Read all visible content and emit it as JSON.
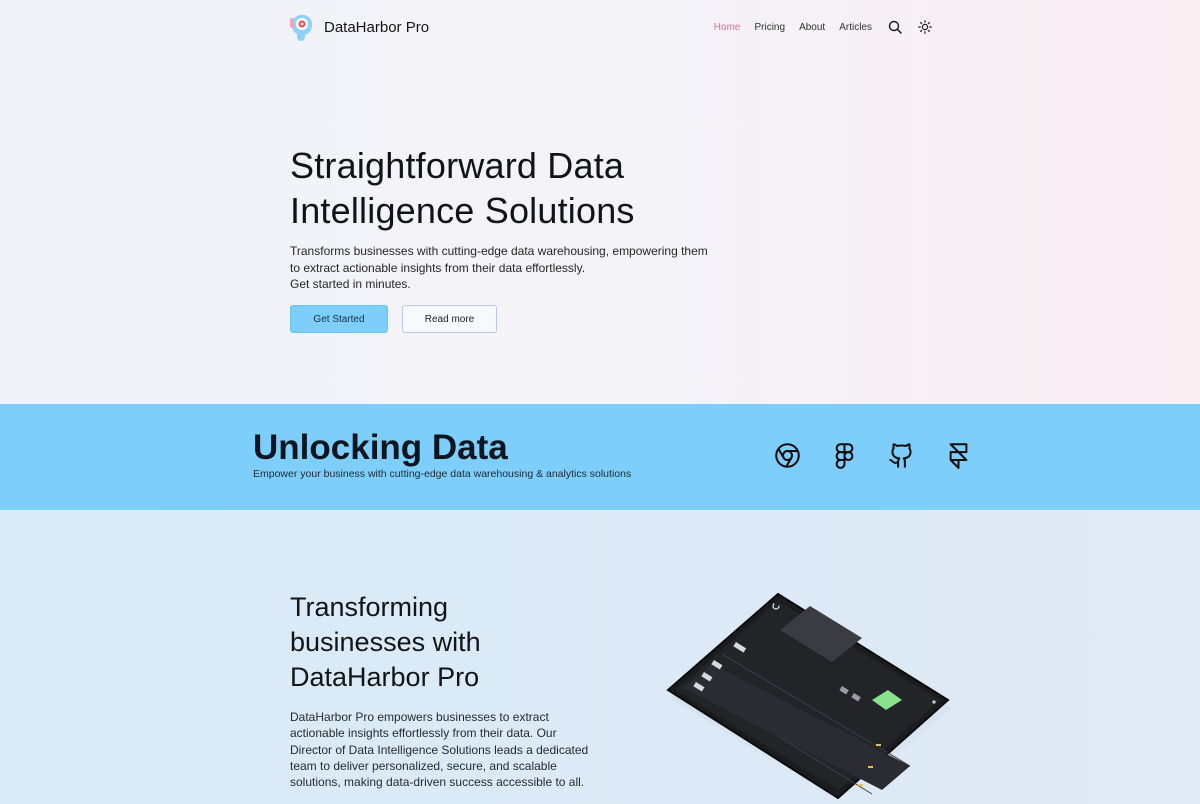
{
  "brand": {
    "name": "DataHarbor Pro"
  },
  "nav": {
    "items": [
      {
        "label": "Home",
        "active": true
      },
      {
        "label": "Pricing"
      },
      {
        "label": "About"
      },
      {
        "label": "Articles"
      }
    ],
    "icons": [
      "search-icon",
      "sun-icon"
    ]
  },
  "hero": {
    "title_line1": "Straightforward Data",
    "title_line2": "Intelligence Solutions",
    "desc_line1": "Transforms businesses with cutting-edge data warehousing, empowering them",
    "desc_line2": "to extract actionable insights from their data effortlessly.",
    "desc_line3": "Get started in minutes.",
    "primary_cta": "Get Started",
    "secondary_cta": "Read more"
  },
  "band": {
    "title": "Unlocking Data",
    "subtitle": "Empower your business with cutting-edge data warehousing & analytics solutions",
    "icons": [
      "chrome-icon",
      "figma-icon",
      "github-icon",
      "framer-icon"
    ]
  },
  "about": {
    "title_line1": "Transforming",
    "title_line2": "businesses with",
    "title_line3": "DataHarbor Pro",
    "desc_line1": "DataHarbor Pro empowers businesses to extract",
    "desc_line2": "actionable insights effortlessly from their data. Our",
    "desc_line3": "Director of Data Intelligence Solutions leads a dedicated",
    "desc_line4": "team to deliver personalized, secure, and scalable",
    "desc_line5": "solutions, making data-driven success accessible to all."
  },
  "colors": {
    "accent_pink": "#ea6b8f",
    "primary_blue": "#7dcef9",
    "band_blue": "#7dcefa",
    "text_dark": "#111318"
  }
}
